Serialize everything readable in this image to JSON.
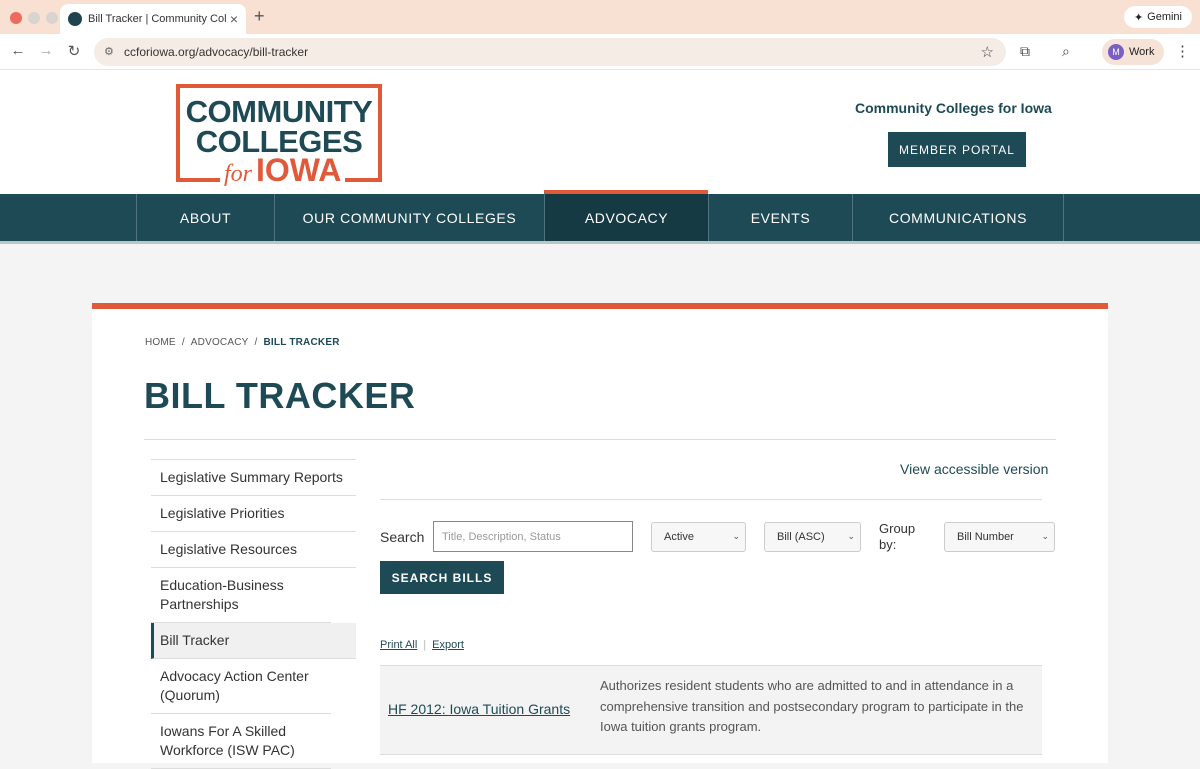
{
  "browser": {
    "tab_title": "Bill Tracker | Community Colle",
    "new_tab": "+",
    "gemini_label": "Gemini",
    "url": "ccforiowa.org/advocacy/bill-tracker",
    "profile_initial": "M",
    "profile_label": "Work"
  },
  "header": {
    "logo_line1": "COMMUNITY",
    "logo_line2": "COLLEGES",
    "logo_for": "for",
    "logo_iowa": "IOWA",
    "org_name": "Community Colleges for Iowa",
    "member_portal": "MEMBER PORTAL"
  },
  "nav": {
    "items": [
      {
        "label": "ABOUT"
      },
      {
        "label": "OUR COMMUNITY COLLEGES"
      },
      {
        "label": "ADVOCACY"
      },
      {
        "label": "EVENTS"
      },
      {
        "label": "COMMUNICATIONS"
      }
    ],
    "active": "ADVOCACY"
  },
  "breadcrumb": {
    "home": "HOME",
    "advocacy": "ADVOCACY",
    "current": "BILL TRACKER",
    "separator": "/"
  },
  "page_title": "BILL TRACKER",
  "sidebar": {
    "items": [
      {
        "label": "Legislative Summary Reports"
      },
      {
        "label": "Legislative Priorities"
      },
      {
        "label": "Legislative Resources"
      },
      {
        "label": "Education-Business Partnerships"
      },
      {
        "label": "Bill Tracker"
      },
      {
        "label": "Advocacy Action Center (Quorum)"
      },
      {
        "label": "Iowans For A Skilled Workforce (ISW PAC)"
      }
    ],
    "active": "Bill Tracker"
  },
  "tracker": {
    "view_accessible": "View accessible version",
    "search_label": "Search",
    "search_placeholder": "Title, Description, Status",
    "status_select": "Active",
    "sort_select": "Bill (ASC)",
    "group_by_label": "Group by:",
    "group_by_select": "Bill Number",
    "search_button": "SEARCH BILLS",
    "print_all": "Print All",
    "export": "Export"
  },
  "bills": [
    {
      "title": "HF 2012: Iowa Tuition Grants",
      "description": "Authorizes resident students who are admitted to and in attendance in a comprehensive transition and postsecondary program to participate in the Iowa tuition grants program."
    }
  ],
  "colors": {
    "brand_teal": "#1e4a56",
    "brand_orange": "#e05a3a"
  }
}
